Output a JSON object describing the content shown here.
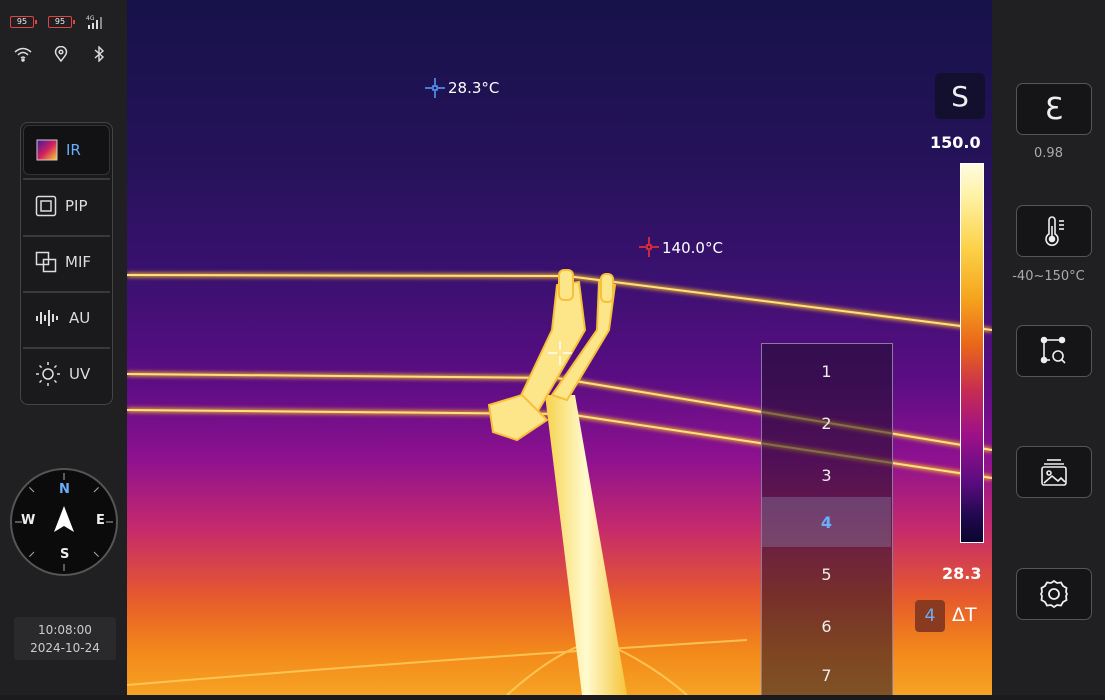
{
  "status": {
    "battery_1": "95",
    "battery_2": "95",
    "signal": "4G"
  },
  "modes": [
    {
      "label": "IR",
      "active": true
    },
    {
      "label": "PIP",
      "active": false
    },
    {
      "label": "MIF",
      "active": false
    },
    {
      "label": "AU",
      "active": false
    },
    {
      "label": "UV",
      "active": false
    }
  ],
  "compass": {
    "n": "N",
    "e": "E",
    "s": "S",
    "w": "W"
  },
  "datetime": {
    "time": "10:08:00",
    "date": "2024-10-24"
  },
  "spots": {
    "min_temp": "28.3°C",
    "max_temp": "140.0°C"
  },
  "scale": {
    "mode_glyph": "S",
    "max": "150.0",
    "min": "28.3"
  },
  "picker": {
    "options": [
      "1",
      "2",
      "3",
      "4",
      "5",
      "6",
      "7"
    ],
    "selected": "4"
  },
  "delta": {
    "value": "4",
    "label": "ΔT"
  },
  "right_panel": {
    "emissivity_glyph": "Ɛ",
    "emissivity_value": "0.98",
    "range_value": "-40~150°C"
  },
  "colors": {
    "accent": "#6aaefc",
    "min_marker": "#5aa0ff",
    "max_marker": "#ff3030"
  }
}
